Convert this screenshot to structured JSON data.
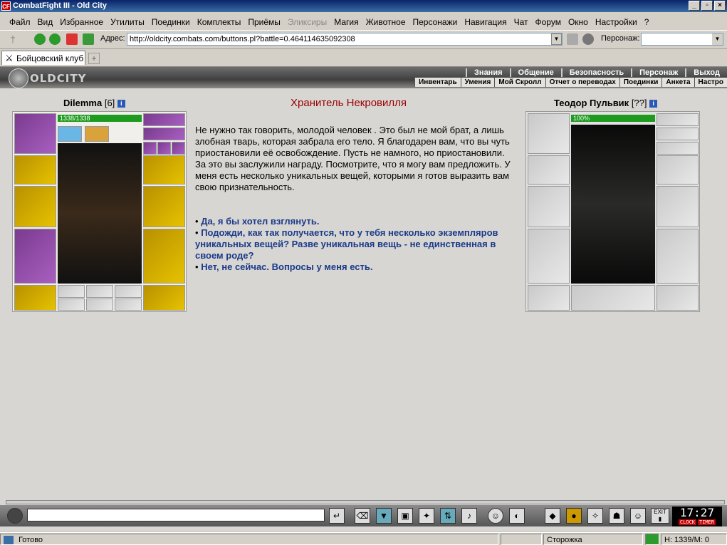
{
  "window": {
    "title": "CombatFight III - Old City",
    "icon_text": "CF",
    "min": "_",
    "max": "▫",
    "close": "×"
  },
  "menu": [
    "Файл",
    "Вид",
    "Избранное",
    "Утилиты",
    "Поединки",
    "Комплекты",
    "Приёмы",
    "Эликсиры",
    "Магия",
    "Животное",
    "Персонажи",
    "Навигация",
    "Чат",
    "Форум",
    "Окно",
    "Настройки",
    "?"
  ],
  "address": {
    "label": "Адрес:",
    "url": "http://oldcity.combats.com/buttons.pl?battle=0.464114635092308",
    "person_label": "Персонаж:"
  },
  "tab": {
    "label": "Бойцовский клуб",
    "new_tab": "+"
  },
  "game": {
    "logo": "OLDCITY",
    "topnav": [
      "Знания",
      "Общение",
      "Безопасность",
      "Персонаж",
      "Выход"
    ],
    "subnav": [
      "Инвентарь",
      "Умения",
      "Мой Скролл",
      "Отчет о переводах",
      "Поединки",
      "Анкета",
      "Настро"
    ]
  },
  "player": {
    "name": "Dilemma",
    "level": "[6]",
    "hp": "1338/1338",
    "hp_fraction": 1.0
  },
  "npc": {
    "name": "Теодор Пульвик",
    "level": "[??]",
    "hp": "100%",
    "hp_fraction": 1.0
  },
  "dialog": {
    "title": "Хранитель Некровилля",
    "text": "Не нужно так говорить, молодой человек . Это был не мой брат, а лишь злобная тварь, которая забрала его тело. Я благодарен вам, что вы чуть приостановили её освобождение. Пусть не намного, но приостановили. За это вы заслужили награду. Посмотрите, что я могу вам предложить. У меня есть несколько уникальных вещей, которыми я готов выразить вам свою признательность.",
    "bullet": "•",
    "options": [
      "Да, я бы хотел взглянуть.",
      "Подожди, как так получается, что у тебя несколько экземпляров уникальных вещей? Разве уникальная вещь - не единственная в своем роде?",
      "Нет, не сейчас. Вопросы у меня есть."
    ]
  },
  "clock": {
    "time": "17:27",
    "labels": [
      "CLOCK",
      "TIMER"
    ],
    "exit": "EXIT"
  },
  "status": {
    "ready": "Готово",
    "location": "Сторожка",
    "coords": "Н: 1339/М: 0"
  }
}
